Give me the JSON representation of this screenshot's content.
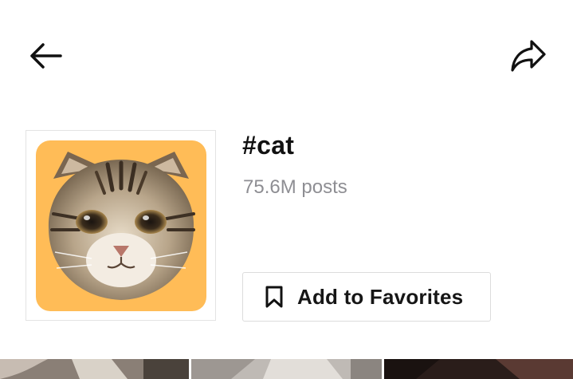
{
  "header": {
    "back_icon": "arrow-left-icon",
    "share_icon": "share-arrow-icon"
  },
  "hashtag": {
    "title": "#cat",
    "posts_count": "75.6M posts",
    "thumbnail": "cat-face-image",
    "thumbnail_bg": "#FFBC57"
  },
  "favorites": {
    "label": "Add to Favorites",
    "icon": "bookmark-icon"
  },
  "video_grid": {
    "items": [
      {
        "thumbnail": "video-thumbnail-1"
      },
      {
        "thumbnail": "video-thumbnail-2"
      },
      {
        "thumbnail": "video-thumbnail-3"
      }
    ]
  }
}
